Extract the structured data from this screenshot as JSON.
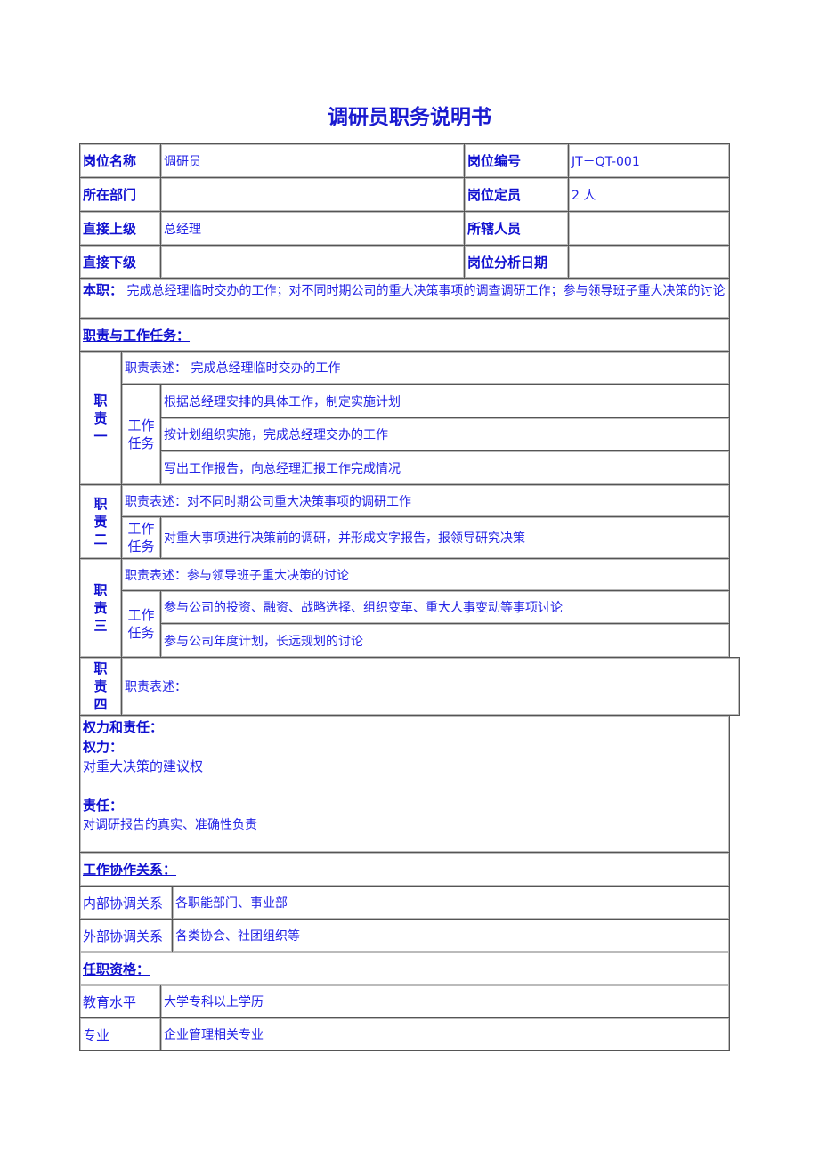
{
  "title": "调研员职务说明书",
  "info": {
    "name_label": "岗位名称",
    "name_value": "调研员",
    "code_label": "岗位编号",
    "code_value": "JT－QT-001",
    "dept_label": "所在部门",
    "dept_value": "",
    "quota_label": "岗位定员",
    "quota_value": "2 人",
    "superior_label": "直接上级",
    "superior_value": "总经理",
    "staff_label": "所辖人员",
    "staff_value": "",
    "subordinate_label": "直接下级",
    "subordinate_value": "",
    "date_label": "岗位分析日期",
    "date_value": ""
  },
  "duty_summary": {
    "label": "本职：",
    "text": " 完成总经理临时交办的工作；对不同时期公司的重大决策事项的调查调研工作；参与领导班子重大决策的讨论"
  },
  "duties_heading": "职责与工作任务：",
  "task_label": "工作任务",
  "duties": [
    {
      "label": "职责一",
      "statement": "职责表述： 完成总经理临时交办的工作",
      "tasks": [
        "根据总经理安排的具体工作，制定实施计划",
        "按计划组织实施，完成总经理交办的工作",
        "写出工作报告，向总经理汇报工作完成情况"
      ]
    },
    {
      "label": "职责二",
      "statement": "职责表述：对不同时期公司重大决策事项的调研工作",
      "tasks": [
        "对重大事项进行决策前的调研，并形成文字报告，报领导研究决策"
      ]
    },
    {
      "label": "职责三",
      "statement": "职责表述：参与领导班子重大决策的讨论",
      "tasks": [
        "参与公司的投资、融资、战略选择、组织变革、重大人事变动等事项讨论",
        "参与公司年度计划，长远规划的讨论"
      ]
    },
    {
      "label": "职责四",
      "statement": "职责表述：",
      "tasks": []
    }
  ],
  "authority": {
    "heading": "权力和责任：",
    "power_label": "权力：",
    "power_text": "对重大决策的建议权",
    "resp_label": "责任：",
    "resp_text": "对调研报告的真实、准确性负责"
  },
  "relations": {
    "heading": "工作协作关系：",
    "internal_label": "内部协调关系",
    "internal_value": "各职能部门、事业部",
    "external_label": "外部协调关系",
    "external_value": "各类协会、社团组织等"
  },
  "qualifications": {
    "heading": "任职资格：",
    "education_label": "教育水平",
    "education_value": "大学专科以上学历",
    "major_label": "专业",
    "major_value": "企业管理相关专业"
  }
}
